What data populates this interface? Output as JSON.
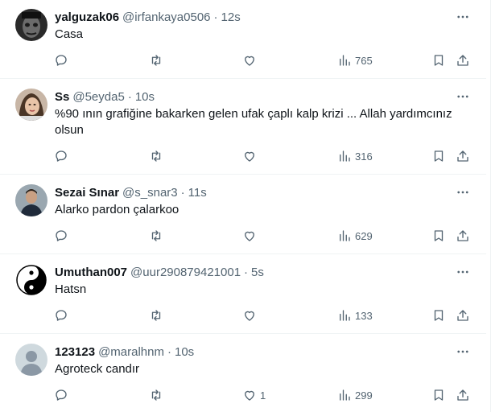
{
  "tweets": [
    {
      "name": "yalguzak06",
      "handle": "@irfankaya0506",
      "separator": "·",
      "time": "12s",
      "text": "Casa",
      "avatar": "dark-face-avatar",
      "replies": "",
      "retweets": "",
      "likes": "",
      "views": "765"
    },
    {
      "name": "Ss",
      "handle": "@5eyda5",
      "separator": "·",
      "time": "10s",
      "text": "%90 ının grafiğine bakarken gelen ufak çaplı kalp krizi ... Allah yardımcınız olsun",
      "avatar": "girl-photo-avatar",
      "replies": "",
      "retweets": "",
      "likes": "",
      "views": "316"
    },
    {
      "name": "Sezai Sınar",
      "handle": "@s_snar3",
      "separator": "·",
      "time": "11s",
      "text": "Alarko pardon çalarkoo",
      "avatar": "man-photo-avatar",
      "replies": "",
      "retweets": "",
      "likes": "",
      "views": "629"
    },
    {
      "name": "Umuthan007",
      "handle": "@uur290879421001",
      "separator": "·",
      "time": "5s",
      "text": "Hatsn",
      "avatar": "yin-yang-avatar",
      "replies": "",
      "retweets": "",
      "likes": "",
      "views": "133"
    },
    {
      "name": "123123",
      "handle": "@maralhnm",
      "separator": "·",
      "time": "10s",
      "text": "Agroteck candır",
      "avatar": "default-profile-avatar",
      "replies": "",
      "retweets": "",
      "likes": "1",
      "views": "299"
    }
  ],
  "icons": {
    "reply": "reply-icon",
    "retweet": "retweet-icon",
    "like": "heart-icon",
    "views": "views-icon",
    "bookmark": "bookmark-icon",
    "share": "share-icon",
    "more": "more-icon"
  },
  "colors": {
    "text": "#0f1419",
    "secondary": "#536471",
    "divider": "#eff3f4"
  }
}
